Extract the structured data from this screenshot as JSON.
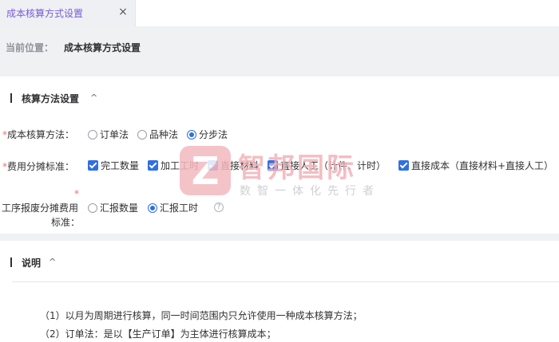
{
  "tab": {
    "label": "成本核算方式设置",
    "close": "×"
  },
  "location": {
    "prefix": "当前位置：",
    "value": "成本核算方式设置"
  },
  "section1": {
    "title": "核算方法设置",
    "chevron": "^",
    "method": {
      "required": "*",
      "label": "成本核算方法：",
      "options": [
        "订单法",
        "品种法",
        "分步法"
      ],
      "selected": "分步法"
    },
    "allocation": {
      "required": "*",
      "label": "费用分摊标准：",
      "items": [
        "完工数量",
        "加工工时",
        "直接材料",
        "直接人工（计件、计时）",
        "直接成本（直接材料+直接人工）"
      ]
    },
    "scrap": {
      "required": "*",
      "label_line1": "工序报废分摊费用",
      "label_line2": "标准：",
      "options": [
        "汇报数量",
        "汇报工时"
      ],
      "selected": "汇报工时",
      "help_icon": "question-circle-icon",
      "help_glyph": "?"
    }
  },
  "section2": {
    "title": "说明",
    "chevron": "^",
    "notes": [
      "（1）以月为周期进行核算，同一时间范围内只允许使用一种成本核算方法；",
      "（2）订单法：是以【生产订单】为主体进行核算成本；"
    ]
  },
  "watermark": {
    "logo_glyph": "Z",
    "name": "智邦国际",
    "slogan": "数智一体化先行者"
  },
  "colors": {
    "accent": "#2f6fe3",
    "tab_text": "#7b5bd6",
    "required": "#f56c6c",
    "watermark": "#f1aeb5"
  }
}
